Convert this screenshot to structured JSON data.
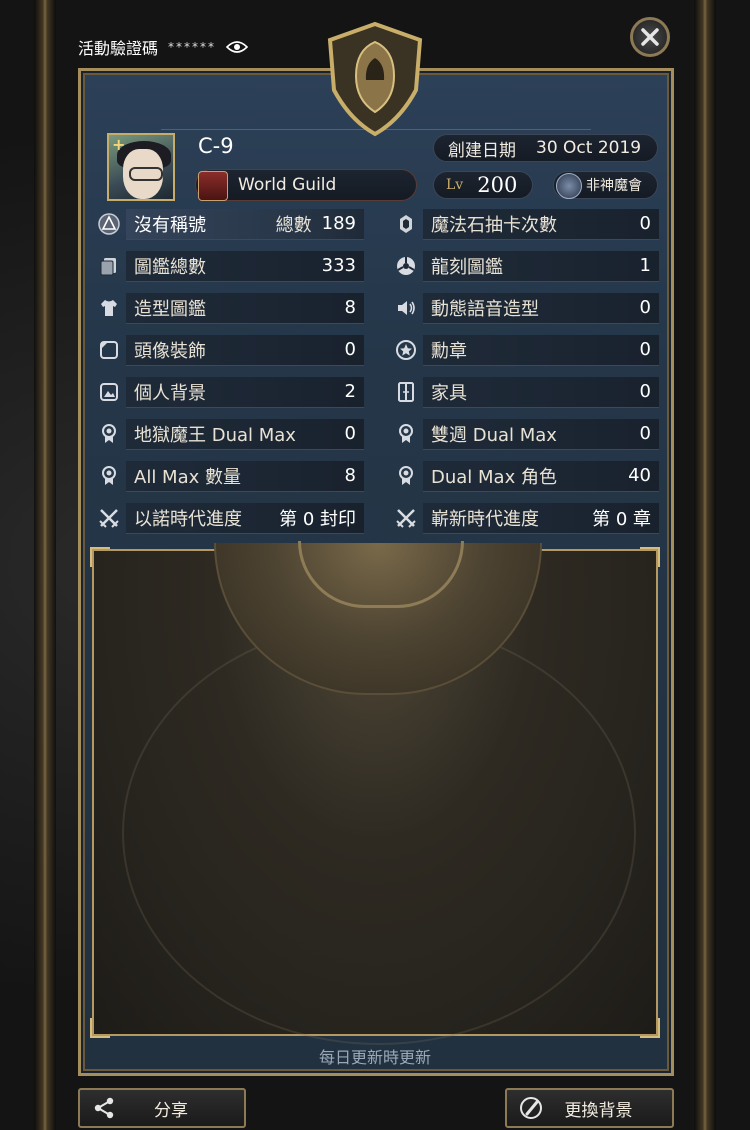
{
  "top_bar": {
    "label": "活動驗證碼",
    "masked_code": "******"
  },
  "profile": {
    "name": "C-9",
    "guild_name": "World Guild",
    "created_label": "創建日期",
    "created_date": "30 Oct 2019",
    "level_label": "Lv",
    "level": "200",
    "guild_rank": "非神魔會"
  },
  "stats_left": [
    {
      "label": "沒有稱號",
      "sub": "總數",
      "value": "189",
      "icon": "title-icon"
    },
    {
      "label": "圖鑑總數",
      "value": "333",
      "icon": "cards-icon"
    },
    {
      "label": "造型圖鑑",
      "value": "8",
      "icon": "shirt-icon"
    },
    {
      "label": "頭像裝飾",
      "value": "0",
      "icon": "frame-icon"
    },
    {
      "label": "個人背景",
      "value": "2",
      "icon": "picture-icon"
    },
    {
      "label": "地獄魔王 Dual Max",
      "value": "0",
      "icon": "medal-icon"
    },
    {
      "label": "All Max 數量",
      "value": "8",
      "icon": "medal-icon"
    },
    {
      "label": "以諾時代進度",
      "value": "第 0 封印",
      "icon": "crossed-swords-icon"
    }
  ],
  "stats_right": [
    {
      "label": "魔法石抽卡次數",
      "value": "0",
      "icon": "stone-icon"
    },
    {
      "label": "龍刻圖鑑",
      "value": "1",
      "icon": "dragon-rune-icon"
    },
    {
      "label": "動態語音造型",
      "value": "0",
      "icon": "speaker-icon"
    },
    {
      "label": "勳章",
      "value": "0",
      "icon": "star-badge-icon"
    },
    {
      "label": "家具",
      "value": "0",
      "icon": "furniture-icon"
    },
    {
      "label": "雙週 Dual Max",
      "value": "0",
      "icon": "medal-icon"
    },
    {
      "label": "Dual Max 角色",
      "value": "40",
      "icon": "medal-icon"
    },
    {
      "label": "嶄新時代進度",
      "value": "第 0 章",
      "icon": "crossed-swords-icon"
    }
  ],
  "footer_note": "每日更新時更新",
  "buttons": {
    "share": "分享",
    "change_background": "更換背景"
  },
  "colors": {
    "panel_blue": "#243648",
    "gold_trim": "#a58e5c",
    "row_bar": "#1f2a38"
  }
}
